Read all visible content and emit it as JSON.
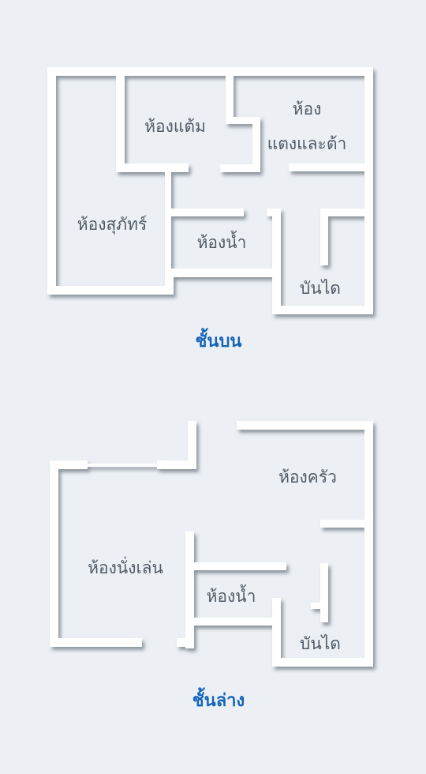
{
  "upper_floor": {
    "title": "ชั้นบน",
    "rooms": {
      "makeup_room": "ห้องแต้ม",
      "dressing_room_line1": "ห้อง",
      "dressing_room_line2": "แตงและต้า",
      "private_room": "ห้องสุภัทร์",
      "bathroom": "ห้องน้ำ",
      "stairs": "บันได"
    }
  },
  "lower_floor": {
    "title": "ชั้นล่าง",
    "rooms": {
      "kitchen": "ห้องครัว",
      "living_room": "ห้องนั่งเล่น",
      "bathroom": "ห้องน้ำ",
      "stairs": "บันได"
    }
  },
  "colors": {
    "background": "#ecf0f4",
    "wall": "#ffffff",
    "wall_shadow": "#7f8a94",
    "label_text": "#505a66",
    "title_text": "#1565b8"
  }
}
